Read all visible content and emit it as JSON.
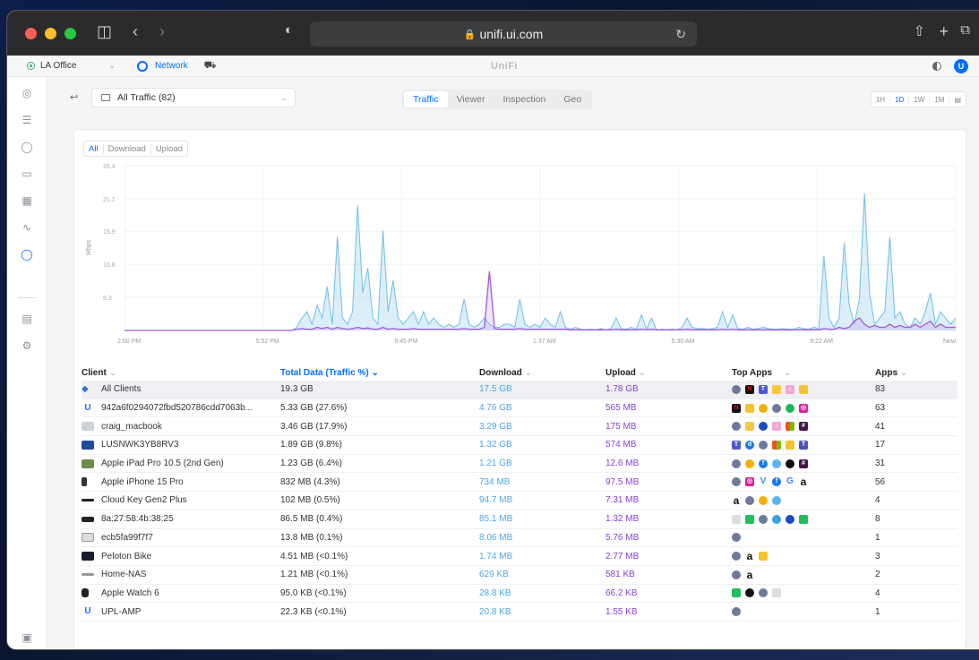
{
  "browser": {
    "url": "unifi.ui.com"
  },
  "header": {
    "site": "LA Office",
    "app": "Network",
    "logo": "UniFi",
    "avatar": "U"
  },
  "filters": {
    "traffic_select": "All Traffic (82)",
    "tabs": [
      "Traffic",
      "Viewer",
      "Inspection",
      "Geo"
    ],
    "active_tab": "Traffic",
    "ranges": [
      "1H",
      "1D",
      "1W",
      "1M"
    ],
    "active_range": "1D"
  },
  "chart_tabs": [
    "All",
    "Download",
    "Upload"
  ],
  "chart_data": {
    "type": "area",
    "ylabel": "Mbps",
    "yticks": [
      5.3,
      10.6,
      15.9,
      21.1,
      26.4
    ],
    "ylim": [
      0,
      26.4
    ],
    "xticks": [
      "2:00 PM",
      "5:52 PM",
      "9:45 PM",
      "1:37 AM",
      "5:30 AM",
      "9:22 AM",
      "Now"
    ],
    "series": [
      {
        "values": [
          0,
          0,
          0,
          0,
          0,
          0,
          0,
          0,
          0,
          0,
          0,
          0,
          0,
          0,
          0,
          0,
          0,
          0,
          0,
          0,
          0,
          0,
          0,
          0,
          0,
          0,
          0,
          0,
          0,
          0,
          0,
          0,
          0,
          0,
          0.5,
          2,
          3,
          1,
          4,
          2,
          7,
          1,
          15,
          2,
          1,
          3,
          20,
          6,
          10,
          2,
          1,
          16,
          3,
          8,
          2,
          1,
          2,
          3,
          1,
          3,
          1,
          2,
          1,
          0.5,
          1,
          0.5,
          1,
          5,
          1,
          0.5,
          1,
          2,
          1,
          0.5,
          0.5,
          1,
          1,
          0.5,
          5,
          1,
          0.5,
          1,
          0.5,
          2,
          1,
          0.5,
          3,
          0.5,
          0.2,
          0.5,
          0.2,
          0.1,
          0.2,
          0.1,
          0.3,
          0.1,
          0.3,
          2,
          0.3,
          0.2,
          0.5,
          0.2,
          2.5,
          0.2,
          2,
          0.1,
          0.2,
          0.1,
          0.2,
          0.1,
          0.5,
          2,
          0.5,
          0.3,
          0.3,
          0.2,
          0.3,
          0.5,
          3,
          0.5,
          2.5,
          0.3,
          0.2,
          0.5,
          0.2,
          0.3,
          0.5,
          0.3,
          0.2,
          0.2,
          0.3,
          0.2,
          0.2,
          0.5,
          0.3,
          0.2,
          0.5,
          0.3,
          12,
          2,
          0.5,
          2,
          14,
          4,
          1,
          5,
          22,
          6,
          1,
          2,
          3,
          15,
          2,
          3,
          1,
          0.5,
          2,
          1,
          3,
          6,
          1,
          3,
          2,
          1,
          2
        ]
      },
      {
        "values": [
          0,
          0,
          0,
          0,
          0,
          0,
          0,
          0,
          0,
          0,
          0,
          0,
          0,
          0,
          0,
          0,
          0,
          0,
          0,
          0,
          0,
          0,
          0,
          0,
          0,
          0,
          0,
          0,
          0,
          0,
          0,
          0,
          0,
          0,
          0.2,
          0.3,
          0.2,
          0.2,
          0.5,
          0.3,
          0.5,
          0.2,
          0.5,
          0.3,
          0.2,
          0.3,
          0.5,
          0.3,
          0.4,
          0.2,
          0.2,
          0.5,
          0.2,
          0.3,
          0.2,
          0.2,
          0.2,
          0.3,
          0.2,
          0.2,
          0.2,
          0.2,
          0.2,
          0.2,
          0.2,
          0.2,
          0.2,
          0.3,
          0.2,
          0.2,
          0.2,
          0.5,
          9.5,
          0.3,
          0.2,
          0.2,
          0.2,
          0.2,
          0.3,
          0.2,
          0.2,
          0.2,
          0.2,
          0.2,
          0.2,
          0.2,
          0.2,
          0.2,
          0.1,
          0.1,
          0.1,
          0.1,
          0.1,
          0.1,
          0.1,
          0.1,
          0.1,
          0.2,
          0.1,
          0.1,
          0.1,
          0.1,
          0.2,
          0.1,
          0.2,
          0.1,
          0.1,
          0.1,
          0.1,
          0.1,
          0.1,
          0.2,
          0.1,
          0.1,
          0.1,
          0.1,
          0.1,
          0.1,
          0.2,
          0.1,
          0.2,
          0.1,
          0.1,
          0.1,
          0.1,
          0.1,
          0.1,
          0.1,
          0.1,
          0.1,
          0.1,
          0.1,
          0.1,
          0.1,
          0.1,
          0.1,
          0.1,
          0.1,
          0.3,
          0.2,
          0.2,
          0.5,
          0.3,
          0.5,
          1.5,
          2,
          1,
          0.5,
          0.8,
          0.5,
          0.5,
          1,
          0.5,
          0.8,
          0.5,
          0.5,
          1,
          0.5,
          1,
          1.5,
          0.5,
          1,
          0.5,
          0.5,
          0.5
        ]
      }
    ],
    "colors": {
      "download": "#6fbfe6",
      "upload": "#a259d9"
    }
  },
  "table": {
    "headers": [
      "Client",
      "Total Data (Traffic %)",
      "Download",
      "Upload",
      "Top Apps",
      "Apps"
    ],
    "rows": [
      {
        "name": "All Clients",
        "icon": "stack",
        "total": "19.3 GB",
        "down": "17.5 GB",
        "up": "1.78 GB",
        "apps": [
          "shield",
          "netflix",
          "teams",
          "folder",
          "itunes",
          "lock"
        ],
        "count": "83"
      },
      {
        "name": "942a6f0294072fbd520786cdd7063b...",
        "icon": "uic",
        "total": "5.33 GB (27.6%)",
        "down": "4.76 GB",
        "up": "565 MB",
        "apps": [
          "netflix",
          "lock",
          "chrome",
          "shield",
          "spotify",
          "instagram"
        ],
        "count": "63"
      },
      {
        "name": "craig_macbook",
        "icon": "laptop",
        "total": "3.46 GB (17.9%)",
        "down": "3.29 GB",
        "up": "175 MB",
        "apps": [
          "shield",
          "folder",
          "dlink",
          "itunes",
          "ms",
          "slack"
        ],
        "count": "41"
      },
      {
        "name": "LUSNWK3YB8RV3",
        "icon": "monitor",
        "total": "1.89 GB (9.8%)",
        "down": "1.32 GB",
        "up": "574 MB",
        "apps": [
          "teams",
          "blue",
          "shield",
          "ms",
          "lock",
          "msteams"
        ],
        "count": "17"
      },
      {
        "name": "Apple iPad Pro 10.5 (2nd Gen)",
        "icon": "ipad",
        "total": "1.23 GB (6.4%)",
        "down": "1.21 GB",
        "up": "12.6 MB",
        "apps": [
          "shield",
          "chrome",
          "fb",
          "cloud",
          "apple",
          "slack"
        ],
        "count": "31"
      },
      {
        "name": "Apple iPhone 15 Pro",
        "icon": "iphone",
        "total": "832 MB (4.3%)",
        "down": "734 MB",
        "up": "97.5 MB",
        "apps": [
          "shield",
          "instagram",
          "venmo",
          "fb",
          "google",
          "amazon"
        ],
        "count": "56"
      },
      {
        "name": "Cloud Key Gen2 Plus",
        "icon": "cloudkey",
        "total": "102 MB (0.5%)",
        "down": "94.7 MB",
        "up": "7.31 MB",
        "apps": [
          "amazon",
          "shield",
          "chrome",
          "cloud"
        ],
        "count": "4"
      },
      {
        "name": "8a:27:58:4b:38:25",
        "icon": "router",
        "total": "86.5 MB (0.4%)",
        "down": "85.1 MB",
        "up": "1.32 MB",
        "apps": [
          "gray",
          "green",
          "shield",
          "globe",
          "dlink",
          "green"
        ],
        "count": "8"
      },
      {
        "name": "ecb5fa99f7f7",
        "icon": "hub",
        "total": "13.8 MB (0.1%)",
        "down": "8.06 MB",
        "up": "5.76 MB",
        "apps": [
          "shield"
        ],
        "count": "1"
      },
      {
        "name": "Peloton Bike",
        "icon": "peloton",
        "total": "4.51 MB (<0.1%)",
        "down": "1.74 MB",
        "up": "2.77 MB",
        "apps": [
          "shield",
          "amazon",
          "lock"
        ],
        "count": "3"
      },
      {
        "name": "Home-NAS",
        "icon": "nas",
        "total": "1.21 MB (<0.1%)",
        "down": "629 KB",
        "up": "581 KB",
        "apps": [
          "shield",
          "amazon"
        ],
        "count": "2"
      },
      {
        "name": "Apple Watch 6",
        "icon": "watch",
        "total": "95.0 KB (<0.1%)",
        "down": "28.8 KB",
        "up": "66.2 KB",
        "apps": [
          "green",
          "apple",
          "shield",
          "gray"
        ],
        "count": "4"
      },
      {
        "name": "UPL-AMP",
        "icon": "uic",
        "total": "22.3 KB (<0.1%)",
        "down": "20.8 KB",
        "up": "1.55 KB",
        "apps": [
          "shield"
        ],
        "count": "1"
      }
    ]
  }
}
